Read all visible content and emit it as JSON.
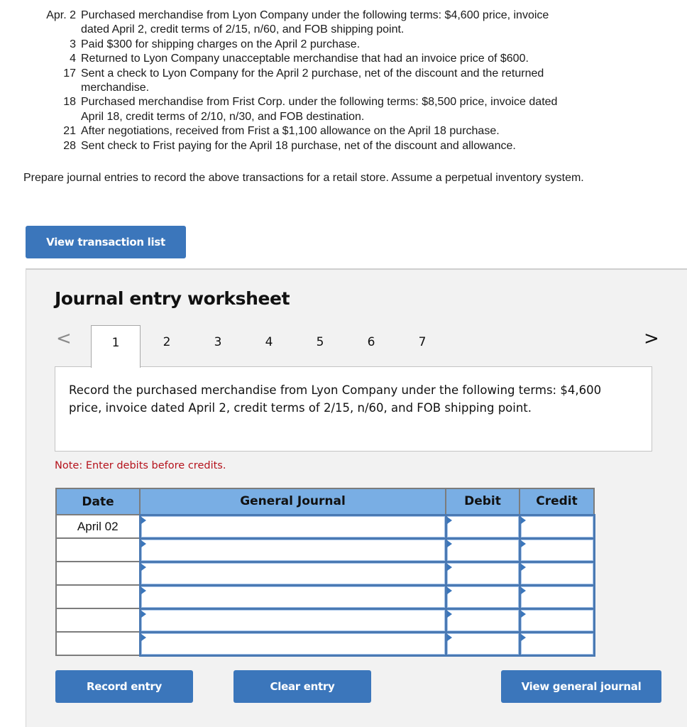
{
  "transactions": [
    {
      "date": "Apr. 2",
      "lines": [
        "Purchased merchandise from Lyon Company under the following terms: $4,600 price, invoice",
        "dated April 2, credit terms of 2/15, n/60, and FOB shipping point."
      ]
    },
    {
      "date": "3",
      "lines": [
        "Paid $300 for shipping charges on the April 2 purchase."
      ]
    },
    {
      "date": "4",
      "lines": [
        "Returned to Lyon Company unacceptable merchandise that had an invoice price of $600."
      ]
    },
    {
      "date": "17",
      "lines": [
        "Sent a check to Lyon Company for the April 2 purchase, net of the discount and the returned",
        "merchandise."
      ]
    },
    {
      "date": "18",
      "lines": [
        "Purchased merchandise from Frist Corp. under the following terms: $8,500 price, invoice dated",
        "April 18, credit terms of 2/10, n/30, and FOB destination."
      ]
    },
    {
      "date": "21",
      "lines": [
        "After negotiations, received from Frist a $1,100 allowance on the April 18 purchase."
      ]
    },
    {
      "date": "28",
      "lines": [
        "Sent check to Frist paying for the April 18 purchase, net of the discount and allowance."
      ]
    }
  ],
  "instructions": "Prepare journal entries to record the above transactions for a retail store. Assume a perpetual inventory system.",
  "buttons": {
    "view_transaction_list": "View transaction list",
    "record_entry": "Record entry",
    "clear_entry": "Clear entry",
    "view_general_journal": "View general journal"
  },
  "worksheet": {
    "title": "Journal entry worksheet",
    "nav_prev_icon": "chevron-left-icon",
    "nav_next_icon": "chevron-right-icon",
    "prev_glyph": "<",
    "next_glyph": ">",
    "tabs": [
      "1",
      "2",
      "3",
      "4",
      "5",
      "6",
      "7"
    ],
    "active_tab": "1",
    "prompt": "Record the purchased merchandise from Lyon Company under the following terms: $4,600 price, invoice dated April 2, credit terms of 2/15, n/60, and FOB shipping point.",
    "note": "Note: Enter debits before credits.",
    "table": {
      "headers": {
        "date": "Date",
        "general_journal": "General Journal",
        "debit": "Debit",
        "credit": "Credit"
      },
      "rows": [
        {
          "date": "April 02",
          "account": "",
          "debit": "",
          "credit": ""
        },
        {
          "date": "",
          "account": "",
          "debit": "",
          "credit": ""
        },
        {
          "date": "",
          "account": "",
          "debit": "",
          "credit": ""
        },
        {
          "date": "",
          "account": "",
          "debit": "",
          "credit": ""
        },
        {
          "date": "",
          "account": "",
          "debit": "",
          "credit": ""
        },
        {
          "date": "",
          "account": "",
          "debit": "",
          "credit": ""
        }
      ]
    }
  },
  "colors": {
    "button_blue": "#3b76bb",
    "table_header_blue": "#79aee4",
    "note_red": "#b5121b",
    "worksheet_bg": "#f2f2f2"
  }
}
